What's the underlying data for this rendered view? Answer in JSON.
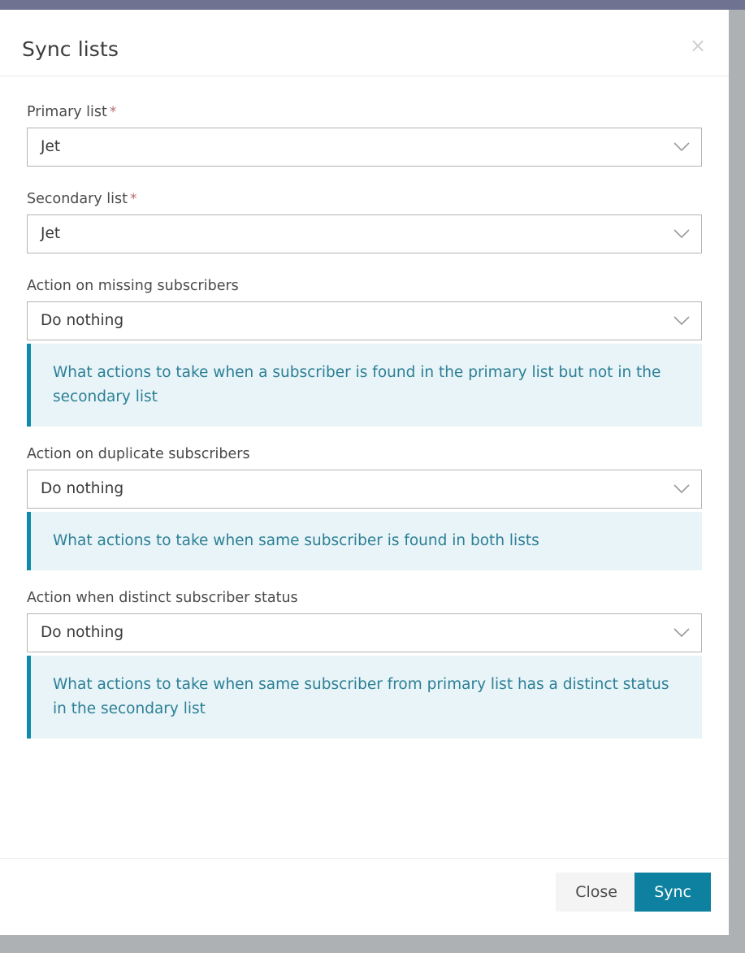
{
  "colors": {
    "backdrop_top": "#6f7391",
    "backdrop": "#adb1b4",
    "modal_bg": "#ffffff",
    "accent_teal": "#0e81a0",
    "info_bg": "#e8f4f7",
    "info_border": "#0e8bab",
    "info_text": "#2c7f96",
    "required_asterisk": "#b56b6b",
    "close_button_bg": "#f4f4f4"
  },
  "modal": {
    "title": "Sync lists",
    "close_icon": "close-icon",
    "close_glyph": "×"
  },
  "fields": [
    {
      "label": "Primary list",
      "required": true,
      "required_marker": "*",
      "value": "Jet",
      "icon": "chevron-down-icon",
      "help": null
    },
    {
      "label": "Secondary list",
      "required": true,
      "required_marker": "*",
      "value": "Jet",
      "icon": "chevron-down-icon",
      "help": null
    },
    {
      "label": "Action on missing subscribers",
      "required": false,
      "required_marker": "",
      "value": "Do nothing",
      "icon": "chevron-down-icon",
      "help": "What actions to take when a subscriber is found in the primary list but not in the secondary list"
    },
    {
      "label": "Action on duplicate subscribers",
      "required": false,
      "required_marker": "",
      "value": "Do nothing",
      "icon": "chevron-down-icon",
      "help": "What actions to take when same subscriber is found in both lists"
    },
    {
      "label": "Action when distinct subscriber status",
      "required": false,
      "required_marker": "",
      "value": "Do nothing",
      "icon": "chevron-down-icon",
      "help": "What actions to take when same subscriber from primary list has a distinct status in the secondary list"
    }
  ],
  "footer": {
    "close_label": "Close",
    "sync_label": "Sync"
  }
}
